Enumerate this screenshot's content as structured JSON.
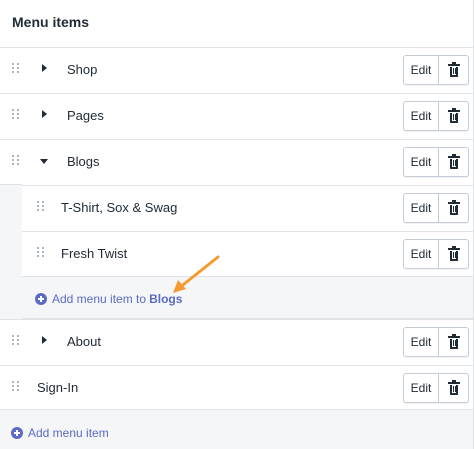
{
  "header": {
    "title": "Menu items"
  },
  "items": [
    {
      "label": "Shop",
      "expanded": false
    },
    {
      "label": "Pages",
      "expanded": false
    },
    {
      "label": "Blogs",
      "expanded": true
    },
    {
      "label": "T-Shirt, Sox & Swag",
      "parent": "Blogs"
    },
    {
      "label": "Fresh Twist",
      "parent": "Blogs"
    },
    {
      "label": "About",
      "expanded": false
    },
    {
      "label": "Sign-In"
    }
  ],
  "actions": {
    "edit_label": "Edit",
    "delete_icon": "trash-icon"
  },
  "nested_add": {
    "prefix": "Add menu item to",
    "target": "Blogs"
  },
  "bottom_add": {
    "label": "Add menu item"
  },
  "annotation": {
    "arrow_color": "#f49a31",
    "icon": "arrow-icon"
  },
  "colors": {
    "accent": "#5c6ac4",
    "border": "#dfe3e8",
    "subdued_bg": "#f4f6f8"
  }
}
